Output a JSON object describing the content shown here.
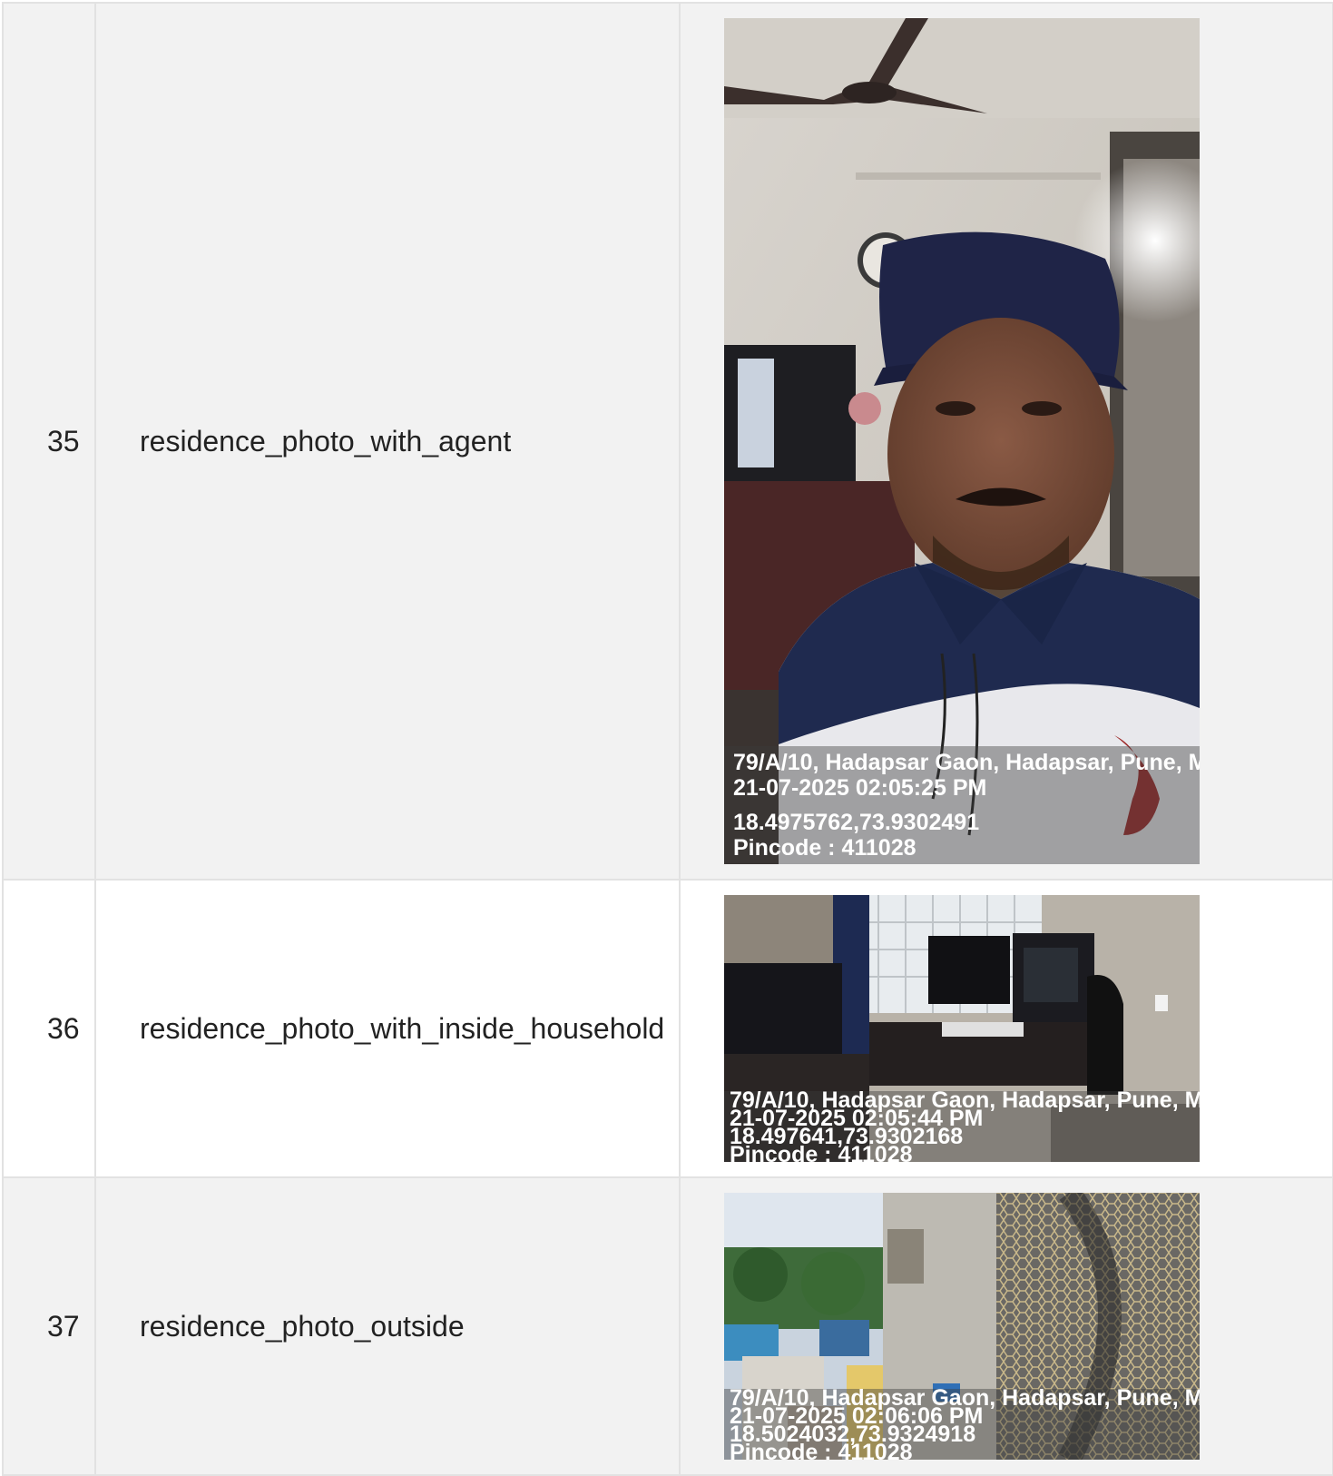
{
  "rows": [
    {
      "index": "35",
      "label": "residence_photo_with_agent",
      "photo": {
        "address": "79/A/10, Hadapsar Gaon, Hadapsar, Pune, M",
        "datetime": "21-07-2025 02:05:25 PM",
        "coords": "18.4975762,73.9302491",
        "pincode": "Pincode : 411028",
        "icon": "selfie-photo-icon"
      }
    },
    {
      "index": "36",
      "label": "residence_photo_with_inside_household",
      "photo": {
        "address": "79/A/10, Hadapsar Gaon, Hadapsar, Pune, M",
        "datetime": "21-07-2025 02:05:44 PM",
        "coords": "18.497641,73.9302168",
        "pincode": "Pincode : 411028",
        "icon": "room-photo-icon"
      }
    },
    {
      "index": "37",
      "label": "residence_photo_outside",
      "photo": {
        "address": "79/A/10, Hadapsar Gaon, Hadapsar, Pune, M",
        "datetime": "21-07-2025 02:06:06 PM",
        "coords": "18.5024032,73.9324918",
        "pincode": "Pincode : 411028",
        "icon": "outdoor-photo-icon"
      }
    }
  ]
}
